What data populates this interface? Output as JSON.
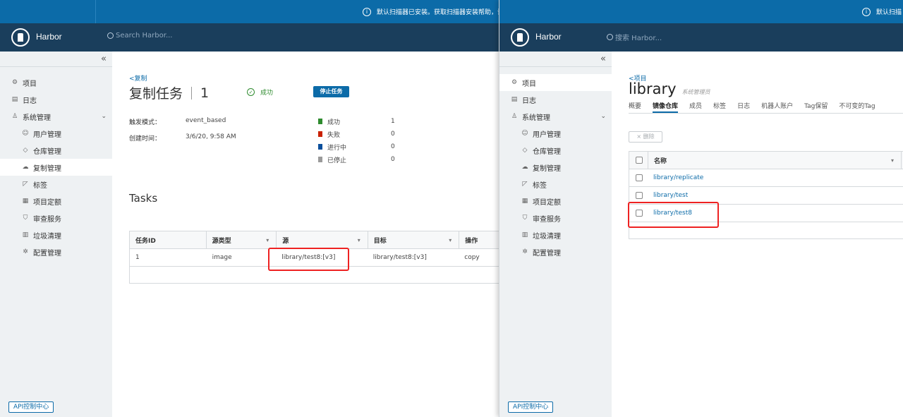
{
  "left": {
    "banner_text": "默认扫描器已安装。获取扫描器安装帮助，请查看",
    "brand": "Harbor",
    "search_placeholder": "Search Harbor...",
    "collapse": "«",
    "nav": {
      "projects": "项目",
      "logs": "日志",
      "admin": "系统管理",
      "users": "用户管理",
      "registries": "仓库管理",
      "replications": "复制管理",
      "labels": "标签",
      "quotas": "项目定额",
      "interrogation": "审查服务",
      "gc": "垃圾清理",
      "config": "配置管理"
    },
    "api_button": "API控制中心",
    "back_link": "<复制",
    "title": "复制任务",
    "job_id": "1",
    "status": "成功",
    "stop_button": "停止任务",
    "trigger_label": "触发模式：",
    "trigger_value": "event_based",
    "created_label": "创建时间：",
    "created_value": "3/6/20, 9:58 AM",
    "stats": [
      {
        "label": "成功",
        "count": "1",
        "color": "#2e8b2e"
      },
      {
        "label": "失败",
        "count": "0",
        "color": "#c92100"
      },
      {
        "label": "进行中",
        "count": "0",
        "color": "#0c4f9c"
      },
      {
        "label": "已停止",
        "count": "0",
        "color": "#9a9a9a"
      }
    ],
    "tasks_heading": "Tasks",
    "table": {
      "headers": [
        "任务ID",
        "源类型",
        "源",
        "目标",
        "操作"
      ],
      "row": [
        "1",
        "image",
        "library/test8:[v3]",
        "library/test8:[v3]",
        "copy"
      ]
    }
  },
  "right": {
    "banner_text": "默认扫描",
    "brand": "Harbor",
    "search_placeholder": "搜索 Harbor...",
    "collapse": "«",
    "nav": {
      "projects": "项目",
      "logs": "日志",
      "admin": "系统管理",
      "users": "用户管理",
      "registries": "仓库管理",
      "replications": "复制管理",
      "labels": "标签",
      "quotas": "项目定额",
      "interrogation": "审查服务",
      "gc": "垃圾清理",
      "config": "配置管理"
    },
    "api_button": "API控制中心",
    "back_link": "<项目",
    "project_name": "library",
    "role": "系统管理员",
    "tabs": [
      "概要",
      "镜像仓库",
      "成员",
      "标签",
      "日志",
      "机器人账户",
      "Tag保留",
      "不可变的Tag"
    ],
    "delete_button": "× 删除",
    "table_header": "名称",
    "repos": [
      "library/replicate",
      "library/test",
      "library/test8"
    ]
  }
}
